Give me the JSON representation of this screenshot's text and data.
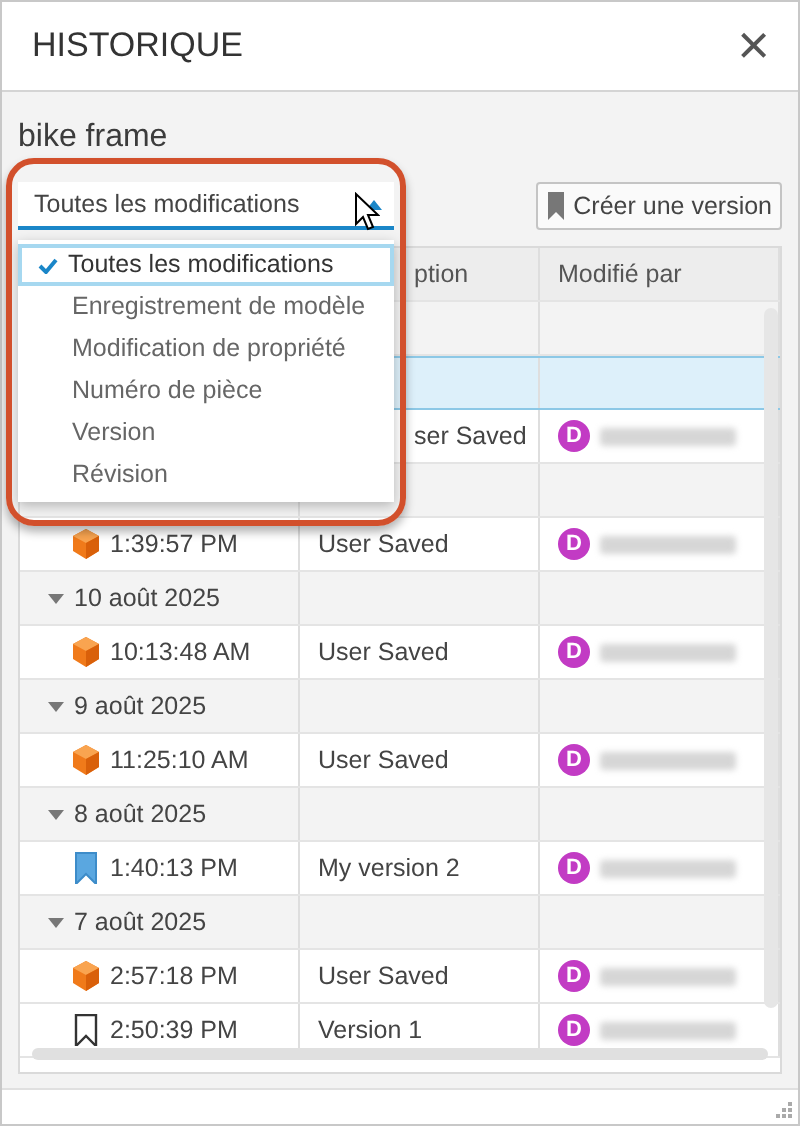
{
  "window": {
    "title": "HISTORIQUE",
    "close": "×"
  },
  "document_name": "bike frame",
  "filter": {
    "value": "Toutes les modifications",
    "expanded": true,
    "options": [
      {
        "label": "Toutes les modifications",
        "selected": true
      },
      {
        "label": "Enregistrement de modèle",
        "selected": false
      },
      {
        "label": "Modification de propriété",
        "selected": false
      },
      {
        "label": "Numéro de pièce",
        "selected": false
      },
      {
        "label": "Version",
        "selected": false
      },
      {
        "label": "Révision",
        "selected": false
      }
    ]
  },
  "create_version_button": "Créer une version",
  "table": {
    "column_2": "ption",
    "column_3": "Modifié par",
    "rows": [
      {
        "kind": "group"
      },
      {
        "kind": "entry",
        "selected": true
      },
      {
        "kind": "entry",
        "selected": false,
        "description": "ser Saved",
        "user_initial": "D"
      },
      {
        "kind": "group"
      },
      {
        "kind": "save",
        "selected": false,
        "time": "1:39:57 PM",
        "description": "User Saved",
        "user_initial": "D"
      },
      {
        "kind": "group",
        "expanded": true,
        "date": "10 août 2025"
      },
      {
        "kind": "save",
        "selected": false,
        "time": "10:13:48 AM",
        "description": "User Saved",
        "user_initial": "D"
      },
      {
        "kind": "group",
        "expanded": true,
        "date": "9 août 2025"
      },
      {
        "kind": "save",
        "selected": false,
        "time": "11:25:10 AM",
        "description": "User Saved",
        "user_initial": "D"
      },
      {
        "kind": "group",
        "expanded": true,
        "date": "8 août 2025"
      },
      {
        "kind": "version",
        "selected": false,
        "time": "1:40:13 PM",
        "description": "My version 2",
        "user_initial": "D"
      },
      {
        "kind": "group",
        "expanded": true,
        "date": "7 août 2025"
      },
      {
        "kind": "save",
        "selected": false,
        "time": "2:57:18 PM",
        "description": "User Saved",
        "user_initial": "D"
      },
      {
        "kind": "milestone",
        "selected": false,
        "time": "2:50:39 PM",
        "description": "Version 1",
        "user_initial": "D"
      }
    ]
  }
}
